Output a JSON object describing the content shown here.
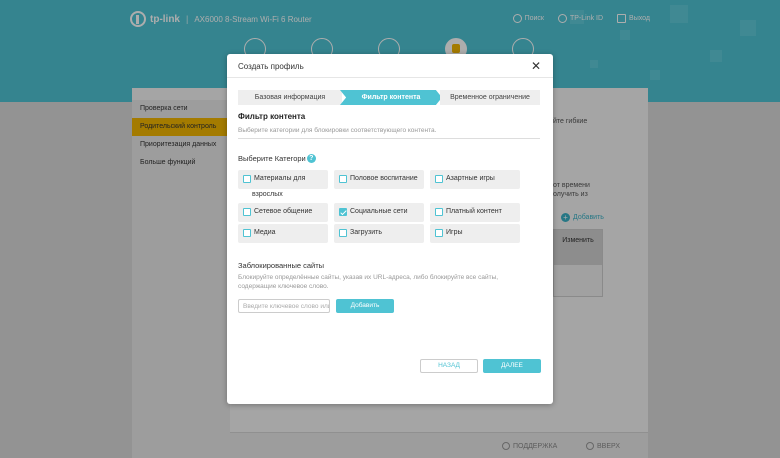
{
  "header": {
    "brand": "tp-link",
    "separator": "|",
    "model": "AX6000 8-Stream Wi-Fi 6 Router",
    "links": {
      "search": "Поиск",
      "tplink_id": "TP-Link ID",
      "logout": "Выход"
    },
    "nav_icons": [
      "network-icon",
      "internet-icon",
      "wireless-icon",
      "security-icon",
      "settings-icon"
    ]
  },
  "sidebar": {
    "items": [
      {
        "label": "Проверка сети"
      },
      {
        "label": "Родительский контроль"
      },
      {
        "label": "Приоритезация данных"
      },
      {
        "label": "Больше функций"
      }
    ]
  },
  "background": {
    "frag_1": "йте гибкие",
    "frag_2": "от времени",
    "frag_3": "олучить из",
    "add_label": "Добавить",
    "table_header": "Изменить"
  },
  "footer": {
    "support": "ПОДДЕРЖКА",
    "top": "ВВЕРХ"
  },
  "modal": {
    "title": "Создать профиль",
    "steps": [
      "Базовая информация",
      "Фильтр контента",
      "Временное ограничение"
    ],
    "section_title": "Фильтр контента",
    "section_desc": "Выберите категории для блокировки соответствующего контента.",
    "categories_label": "Выберите Категори",
    "categories": [
      {
        "label": "Материалы для",
        "label2": "взрослых",
        "checked": false
      },
      {
        "label": "Половое воспитание",
        "checked": false
      },
      {
        "label": "Азартные игры",
        "checked": false
      },
      {
        "label": "Сетевое общение",
        "checked": false
      },
      {
        "label": "Социальные сети",
        "checked": true
      },
      {
        "label": "Платный контент",
        "checked": false
      },
      {
        "label": "Медиа",
        "checked": false
      },
      {
        "label": "Загрузить",
        "checked": false
      },
      {
        "label": "Игры",
        "checked": false
      }
    ],
    "blocked_title": "Заблокированные сайты",
    "blocked_desc": "Блокируйте определённые сайты, указав их URL-адреса, либо блокируйте все сайты, содержащие ключевое слово.",
    "keyword_placeholder": "Введите ключевое слово или",
    "add_button": "Добавить",
    "back_button": "НАЗАД",
    "next_button": "ДАЛЕЕ"
  },
  "colors": {
    "accent": "#4fc3d3",
    "selected_nav": "#f2b600"
  }
}
